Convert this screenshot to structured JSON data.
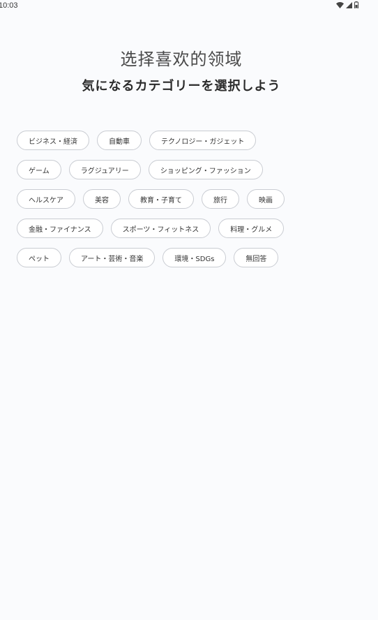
{
  "status_bar": {
    "time": "10:03",
    "icons": [
      "wifi-icon",
      "signal-icon",
      "battery-icon"
    ]
  },
  "header": {
    "title_zh": "选择喜欢的领域",
    "title_ja": "気になるカテゴリーを選択しよう"
  },
  "categories": [
    [
      "ビジネス・経済",
      "自動車",
      "テクノロジー・ガジェット"
    ],
    [
      "ゲーム",
      "ラグジュアリー",
      "ショッピング・ファッション"
    ],
    [
      "ヘルスケア",
      "美容",
      "教育・子育て",
      "旅行",
      "映画"
    ],
    [
      "金融・ファイナンス",
      "スポーツ・フィットネス",
      "料理・グルメ"
    ],
    [
      "ペット",
      "アート・芸術・音楽",
      "環境・SDGs",
      "無回答"
    ]
  ],
  "colors": {
    "background": "#fafbfd",
    "tag_border": "#c9ccd2",
    "tag_bg": "#ffffff"
  }
}
